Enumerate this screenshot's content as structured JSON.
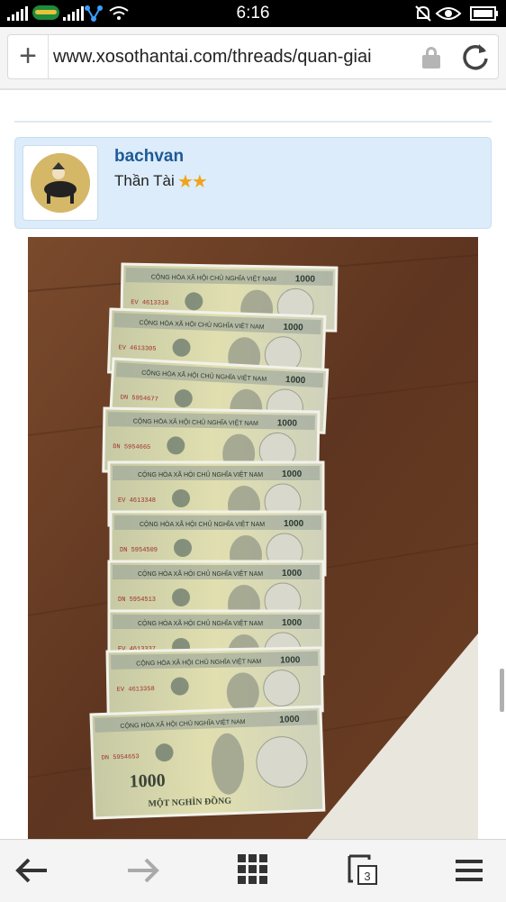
{
  "status_bar": {
    "time": "6:16",
    "icons": [
      "signal-icon",
      "carrier-icon",
      "signal-icon",
      "network-icon",
      "wifi-icon",
      "mute-icon",
      "eye-icon",
      "battery-icon"
    ]
  },
  "browser": {
    "url": "www.xosothantai.com/threads/quan-giai",
    "new_tab_icon": "plus-icon",
    "secure_icon": "lock-icon",
    "reload_icon": "reload-icon"
  },
  "post": {
    "username": "bachvan",
    "user_title": "Thần Tài",
    "user_title_stars": "★★"
  },
  "photo": {
    "description_icon": "banknotes-photo",
    "banknotes": [
      {
        "header": "CỘNG HÒA XÃ HỘI CHỦ NGHĨA VIỆT NAM",
        "serial": "EV 4613318",
        "denomination": "1000"
      },
      {
        "header": "CỘNG HÒA XÃ HỘI CHỦ NGHĨA VIỆT NAM",
        "serial": "EV 4613305",
        "denomination": "1000"
      },
      {
        "header": "CỘNG HÒA XÃ HỘI CHỦ NGHĨA VIỆT NAM",
        "serial": "DN 5954677",
        "denomination": "1000"
      },
      {
        "header": "CỘNG HÒA XÃ HỘI CHỦ NGHĨA VIỆT NAM",
        "serial": "DN 5954665",
        "denomination": "1000"
      },
      {
        "header": "CỘNG HÒA XÃ HỘI CHỦ NGHĨA VIỆT NAM",
        "serial": "EV 4613348",
        "denomination": "1000"
      },
      {
        "header": "CỘNG HÒA XÃ HỘI CHỦ NGHĨA VIỆT NAM",
        "serial": "DN 5954509",
        "denomination": "1000"
      },
      {
        "header": "CỘNG HÒA XÃ HỘI CHỦ NGHĨA VIỆT NAM",
        "serial": "DN 5954513",
        "denomination": "1000"
      },
      {
        "header": "CỘNG HÒA XÃ HỘI CHỦ NGHĨA VIỆT NAM",
        "serial": "EV 4613337",
        "denomination": "1000"
      },
      {
        "header": "CỘNG HÒA XÃ HỘI CHỦ NGHĨA VIỆT NAM",
        "serial": "EV 4613358",
        "denomination": "1000"
      },
      {
        "header": "CỘNG HÒA XÃ HỘI CHỦ NGHĨA VIỆT NAM",
        "serial": "DN 5954653",
        "denomination": "1000",
        "words": "MỘT NGHÌN ĐỒNG"
      }
    ]
  },
  "bottom_nav": {
    "back_icon": "back-arrow-icon",
    "forward_icon": "forward-arrow-icon",
    "apps_icon": "grid-icon",
    "tabs_icon": "tabs-icon",
    "tab_count": "3",
    "menu_icon": "menu-icon"
  }
}
